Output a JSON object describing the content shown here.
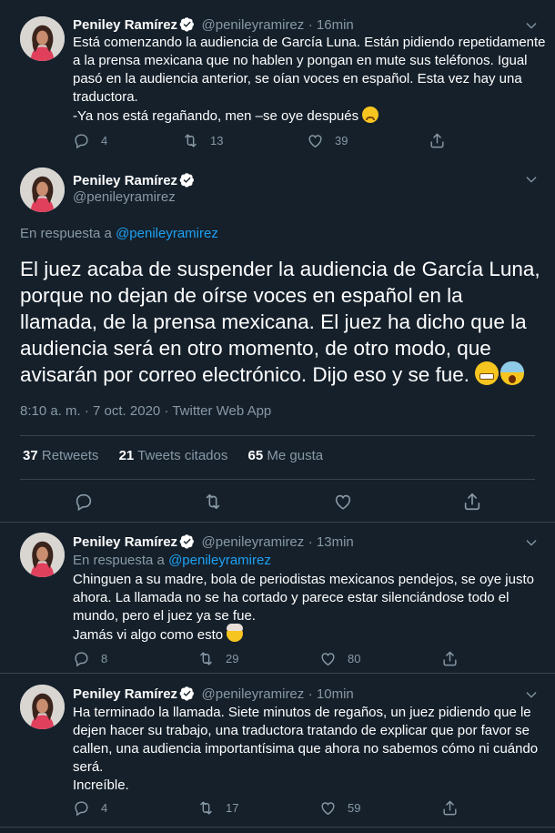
{
  "author": {
    "name": "Peniley Ramírez",
    "handle": "@penileyramirez"
  },
  "tweet1": {
    "time": "· 16min",
    "lines": [
      "Está comenzando la audiencia de García Luna. Están pidiendo repetidamente",
      "a la prensa mexicana que no hablen y pongan en mute sus teléfonos. Igual",
      "pasó en la audiencia anterior, se oían voces en español. Esta vez hay una",
      "traductora.",
      "-Ya nos está regañando, men –se oye después"
    ],
    "replies": "4",
    "retweets": "13",
    "likes": "39"
  },
  "main": {
    "reply_to_label": "En respuesta a",
    "reply_to": "@penileyramirez",
    "lines": [
      "El juez acaba de suspender la audiencia de García Luna,",
      "porque no dejan de oírse voces en español en la",
      "llamada, de la prensa mexicana. El juez ha dicho que la",
      "audiencia será en otro momento, de otro modo, que",
      "avisarán por correo electrónico. Dijo eso y se fue."
    ],
    "meta": "8:10 a. m. · 7 oct. 2020 · Twitter Web App",
    "stats": {
      "retweets": "37",
      "retweets_label": "Retweets",
      "quotes": "21",
      "quotes_label": "Tweets citados",
      "likes": "65",
      "likes_label": "Me gusta"
    }
  },
  "tweet3": {
    "time": "· 13min",
    "reply_to_label": "En respuesta a",
    "reply_to": "@penileyramirez",
    "lines": [
      "Chinguen a su madre, bola de periodistas mexicanos pendejos, se oye justo",
      "ahora. La llamada no se ha cortado y parece estar silenciándose todo el",
      "mundo, pero el juez ya se fue.",
      "Jamás vi algo como esto"
    ],
    "replies": "8",
    "retweets": "29",
    "likes": "80"
  },
  "tweet4": {
    "time": "· 10min",
    "lines": [
      "Ha terminado la llamada. Siete minutos de regaños, un juez pidiendo que le",
      "dejen hacer su trabajo, una traductora tratando de explicar que por favor se",
      "callen, una audiencia importantísima que ahora no sabemos cómo ni cuándo",
      "será.",
      "Increíble."
    ],
    "replies": "4",
    "retweets": "17",
    "likes": "59"
  },
  "colors": {
    "background": "#15202b",
    "text": "#ffffff",
    "secondary": "#8899a6",
    "accent": "#1da1f2",
    "divider": "#38444d"
  },
  "icons": [
    "reply-icon",
    "retweet-icon",
    "like-icon",
    "share-icon",
    "verified-icon",
    "chevron-down-icon"
  ]
}
